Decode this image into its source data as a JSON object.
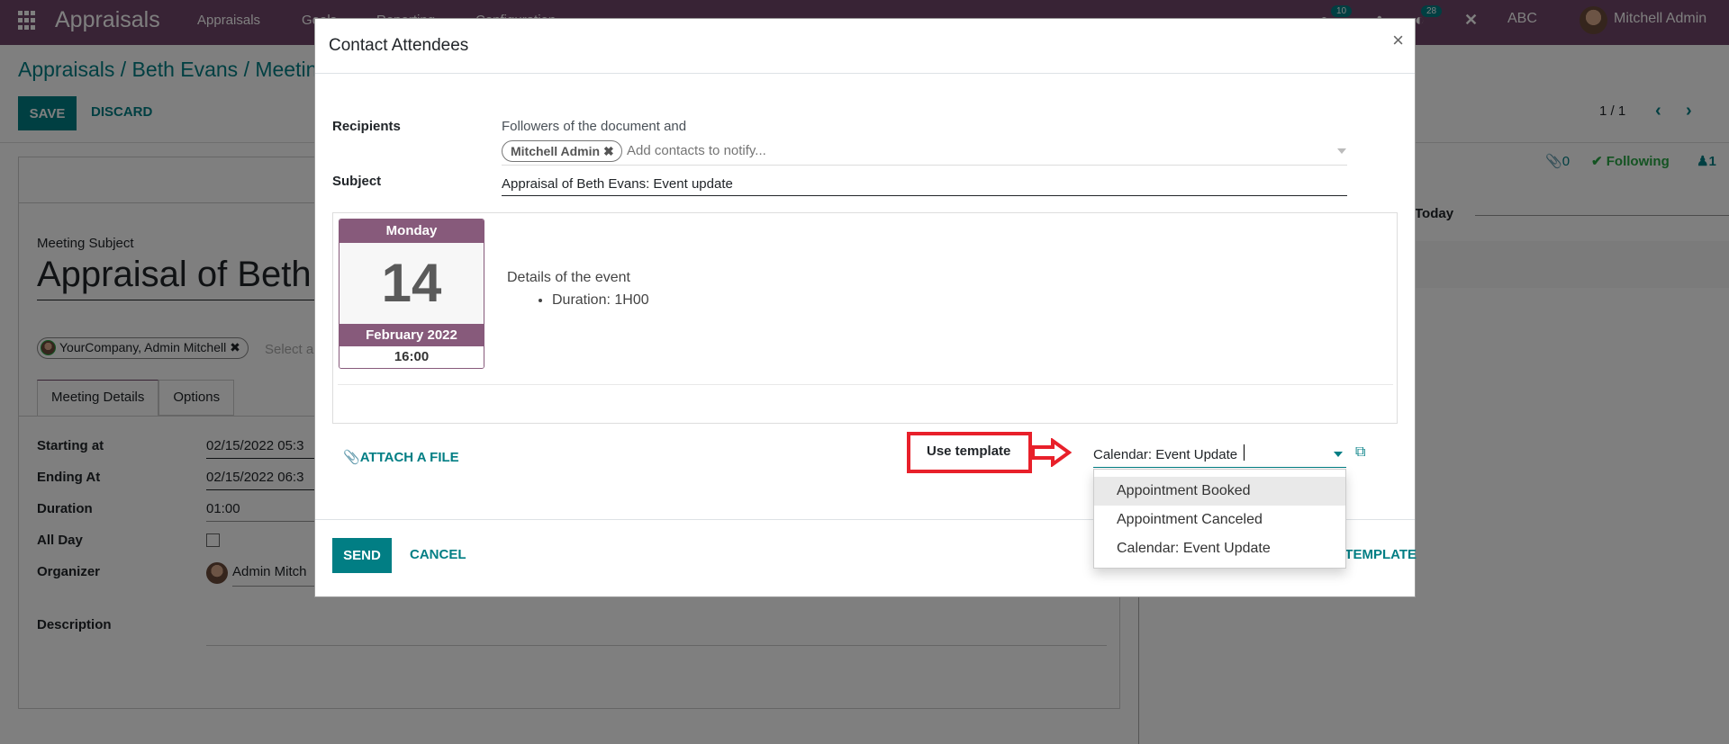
{
  "navbar": {
    "brand": "Appraisals",
    "menu": [
      "Appraisals",
      "Goals",
      "Reporting",
      "Configuration"
    ],
    "messages_count": "10",
    "activities_count": "28",
    "company": "ABC",
    "user": "Mitchell Admin"
  },
  "control_panel": {
    "breadcrumb": "Appraisals / Beth Evans / Meeting",
    "save_label": "SAVE",
    "discard_label": "DISCARD",
    "pager": "1 / 1"
  },
  "form": {
    "meeting_subject_label": "Meeting Subject",
    "meeting_title": "Appraisal of Beth",
    "attendee_chip": "YourCompany, Admin Mitchell",
    "attendee_placeholder": "Select a",
    "tabs": [
      "Meeting Details",
      "Options"
    ],
    "fields": [
      {
        "label": "Starting at",
        "value": "02/15/2022 05:3"
      },
      {
        "label": "Ending At",
        "value": "02/15/2022 06:3"
      },
      {
        "label": "Duration",
        "value": "01:00"
      },
      {
        "label": "All Day",
        "value": ""
      },
      {
        "label": "Organizer",
        "value": "Admin Mitch"
      }
    ],
    "description_label": "Description"
  },
  "chatter": {
    "attachments_count": "0",
    "following_label": "Following",
    "followers_count": "1",
    "today_label": "Today"
  },
  "modal": {
    "title": "Contact Attendees",
    "close_icon": "×",
    "recipients_label": "Recipients",
    "recipients_text": "Followers of the document and",
    "recipient_chip": "Mitchell Admin",
    "recipients_placeholder": "Add contacts to notify...",
    "subject_label": "Subject",
    "subject_value": "Appraisal of Beth Evans: Event update",
    "calendar": {
      "weekday": "Monday",
      "day": "14",
      "month_year": "February 2022",
      "time": "16:00"
    },
    "event_details_title": "Details of the event",
    "event_details_items": [
      "Duration: 1H00"
    ],
    "attach_label": "ATTACH A FILE",
    "use_template_label": "Use template",
    "template_value": "Calendar: Event Update",
    "template_options": [
      "Appointment Booked",
      "Appointment Canceled",
      "Calendar: Event Update"
    ],
    "highlighted_option": "Appointment Booked",
    "send_label": "SEND",
    "cancel_label": "CANCEL",
    "save_template_label": "SAVE AS NEW TEMPLATE"
  },
  "colors": {
    "brand": "#71466a",
    "primary": "#017e84",
    "calendar_accent": "#875a7b",
    "annotation_red": "#e8202a"
  }
}
